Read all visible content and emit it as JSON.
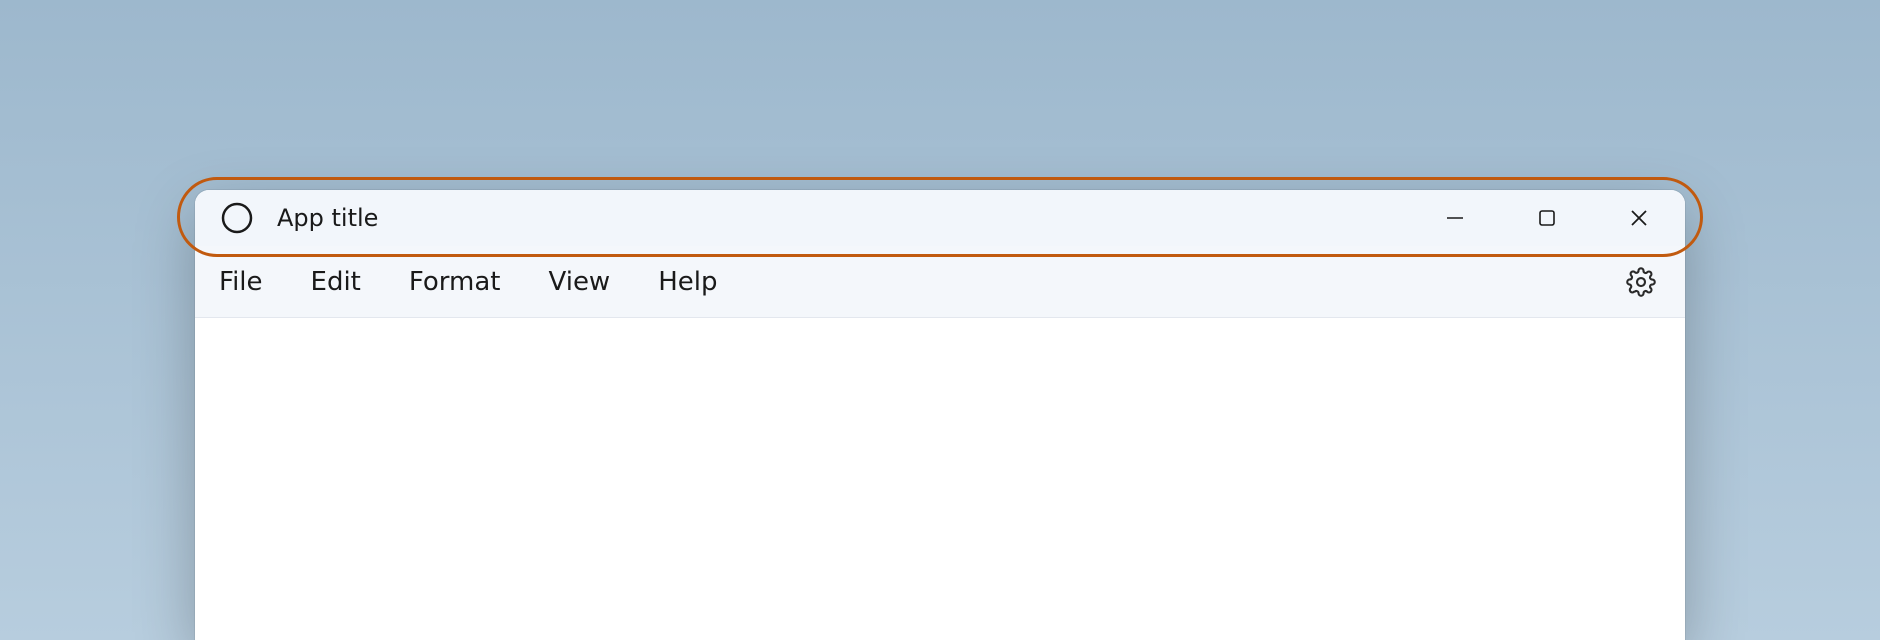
{
  "titlebar": {
    "app_title": "App title",
    "icon": "app-circle-icon",
    "controls": {
      "minimize": "minimize-icon",
      "maximize": "maximize-icon",
      "close": "close-icon"
    }
  },
  "menubar": {
    "items": [
      {
        "label": "File"
      },
      {
        "label": "Edit"
      },
      {
        "label": "Format"
      },
      {
        "label": "View"
      },
      {
        "label": "Help"
      }
    ],
    "settings_icon": "gear-icon"
  },
  "highlight": {
    "color": "#c15a0f",
    "target": "titlebar"
  }
}
